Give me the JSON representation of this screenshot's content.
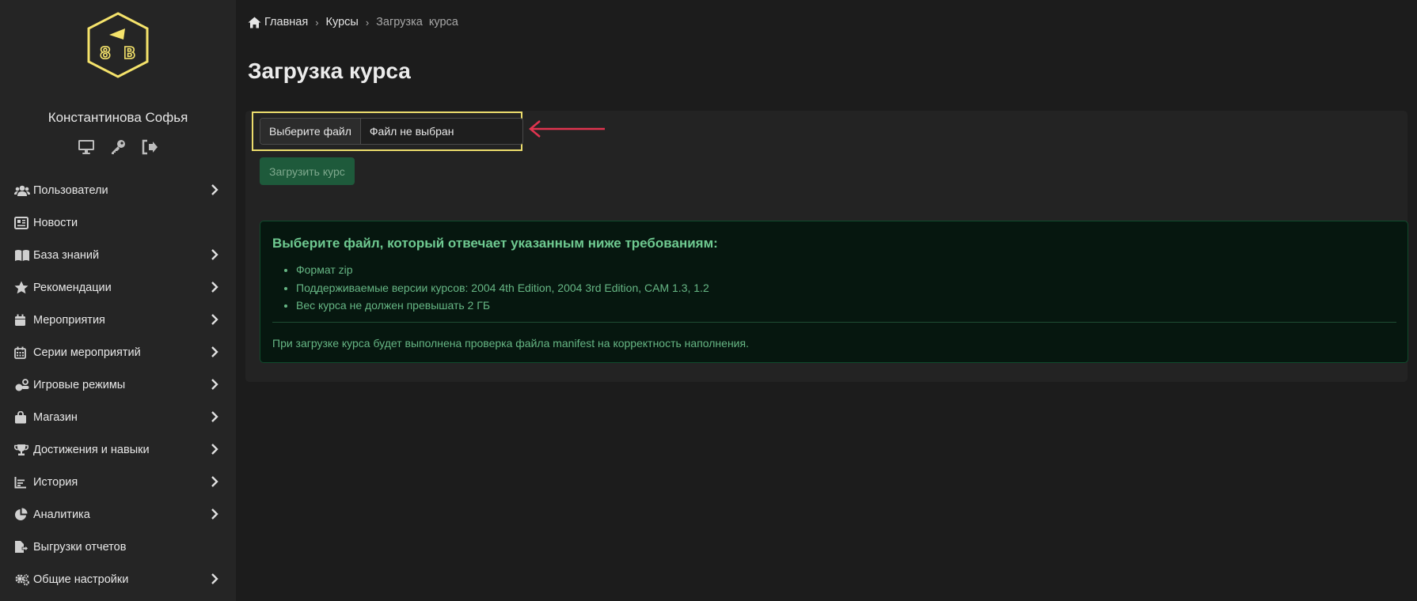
{
  "sidebar": {
    "user_name": "Константинова Софья",
    "user_icons": [
      "monitor-icon",
      "key-icon",
      "logout-icon"
    ],
    "items": [
      {
        "label": "Пользователи",
        "icon": "users-icon",
        "has_children": true
      },
      {
        "label": "Новости",
        "icon": "newspaper-icon",
        "has_children": false
      },
      {
        "label": "База знаний",
        "icon": "book-icon",
        "has_children": true
      },
      {
        "label": "Рекомендации",
        "icon": "star-icon",
        "has_children": true
      },
      {
        "label": "Мероприятия",
        "icon": "calendar-icon",
        "has_children": true
      },
      {
        "label": "Серии мероприятий",
        "icon": "calendar-grid-icon",
        "has_children": true
      },
      {
        "label": "Игровые режимы",
        "icon": "game-icon",
        "has_children": true
      },
      {
        "label": "Магазин",
        "icon": "shopping-bag-icon",
        "has_children": true
      },
      {
        "label": "Достижения и навыки",
        "icon": "trophy-icon",
        "has_children": true
      },
      {
        "label": "История",
        "icon": "chart-line-icon",
        "has_children": true
      },
      {
        "label": "Аналитика",
        "icon": "pie-chart-icon",
        "has_children": true
      },
      {
        "label": "Выгрузки отчетов",
        "icon": "file-export-icon",
        "has_children": false
      },
      {
        "label": "Общие настройки",
        "icon": "cogs-icon",
        "has_children": true
      }
    ]
  },
  "breadcrumb": {
    "home": "Главная",
    "courses": "Курсы",
    "current": "Загрузка  курса",
    "separator": "›"
  },
  "page": {
    "title": "Загрузка курса",
    "file_button": "Выберите файл",
    "file_status": "Файл не выбран",
    "upload_button": "Загрузить курс"
  },
  "info": {
    "title": "Выберите файл, который отвечает указанным ниже требованиям:",
    "requirements": [
      "Формат zip",
      "Поддерживаемые версии курсов: 2004 4th Edition, 2004 3rd Edition, CAM 1.3, 1.2",
      "Вес курса не должен превышать 2 ГБ"
    ],
    "note": "При загрузке курса будет выполнена проверка файла manifest на корректность наполнения."
  },
  "colors": {
    "accent_logo": "#f5e36b",
    "highlight_box": "#ecdc6c",
    "annotation_arrow": "#e0344f",
    "upload_button_bg": "#1e5a3b",
    "info_text": "#66b684"
  }
}
